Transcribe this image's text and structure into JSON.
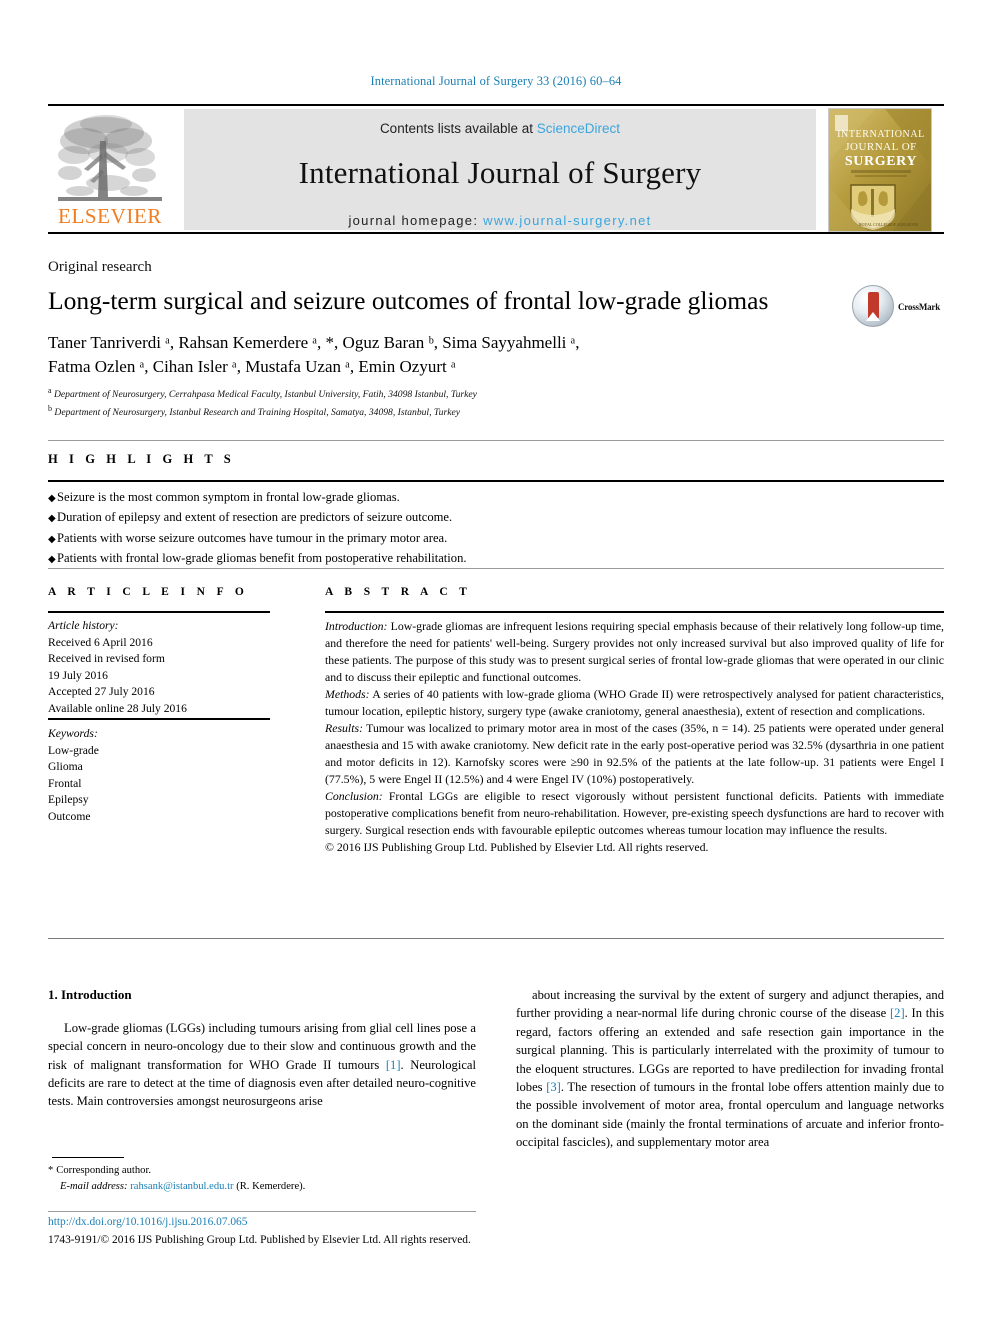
{
  "running_head": "International Journal of Surgery 33 (2016) 60–64",
  "masthead": {
    "publisher_logo_label": "ELSEVIER",
    "contents_prefix": "Contents lists available at ",
    "contents_link": "ScienceDirect",
    "journal_title": "International Journal of Surgery",
    "homepage_prefix": "journal homepage: ",
    "homepage_url": "www.journal-surgery.net",
    "cover_thumb_lines": [
      "INTERNATIONAL",
      "JOURNAL OF",
      "SURGERY"
    ]
  },
  "article": {
    "type": "Original research",
    "title": "Long-term surgical and seizure outcomes of frontal low-grade gliomas",
    "crossmark_label": "CrossMark",
    "authors_line_1": "Taner Tanriverdi ᵃ, Rahsan Kemerdere ᵃ, *, Oguz Baran ᵇ, Sima Sayyahmelli ᵃ,",
    "authors_line_2": "Fatma Ozlen ᵃ, Cihan Isler ᵃ, Mustafa Uzan ᵃ, Emin Ozyurt ᵃ",
    "authors": [
      {
        "name": "Taner Tanriverdi",
        "marks": "a"
      },
      {
        "name": "Rahsan Kemerdere",
        "marks": "a, *"
      },
      {
        "name": "Oguz Baran",
        "marks": "b"
      },
      {
        "name": "Sima Sayyahmelli",
        "marks": "a"
      },
      {
        "name": "Fatma Ozlen",
        "marks": "a"
      },
      {
        "name": "Cihan Isler",
        "marks": "a"
      },
      {
        "name": "Mustafa Uzan",
        "marks": "a"
      },
      {
        "name": "Emin Ozyurt",
        "marks": "a"
      }
    ],
    "affiliations": [
      {
        "mark": "a",
        "text": "Department of Neurosurgery, Cerrahpasa Medical Faculty, Istanbul University, Fatih, 34098 Istanbul, Turkey"
      },
      {
        "mark": "b",
        "text": "Department of Neurosurgery, Istanbul Research and Training Hospital, Samatya, 34098, Istanbul, Turkey"
      }
    ]
  },
  "highlights": {
    "heading": "H I G H L I G H T S",
    "items": [
      "Seizure is the most common symptom in frontal low-grade gliomas.",
      "Duration of epilepsy and extent of resection are predictors of seizure outcome.",
      "Patients with worse seizure outcomes have tumour in the primary motor area.",
      "Patients with frontal low-grade gliomas benefit from postoperative rehabilitation."
    ]
  },
  "article_info": {
    "heading": "A R T I C L E  I N F O",
    "history_label": "Article history:",
    "history": [
      "Received 6 April 2016",
      "Received in revised form",
      "19 July 2016",
      "Accepted 27 July 2016",
      "Available online 28 July 2016"
    ],
    "keywords_label": "Keywords:",
    "keywords": [
      "Low-grade",
      "Glioma",
      "Frontal",
      "Epilepsy",
      "Outcome"
    ]
  },
  "abstract": {
    "heading": "A B S T R A C T",
    "sections": [
      {
        "label": "Introduction:",
        "text": " Low-grade gliomas are infrequent lesions requiring special emphasis because of their relatively long follow-up time, and therefore the need for patients' well-being. Surgery provides not only increased survival but also improved quality of life for these patients. The purpose of this study was to present surgical series of frontal low-grade gliomas that were operated in our clinic and to discuss their epileptic and functional outcomes."
      },
      {
        "label": "Methods:",
        "text": " A series of 40 patients with low-grade glioma (WHO Grade II) were retrospectively analysed for patient characteristics, tumour location, epileptic history, surgery type (awake craniotomy, general anaesthesia), extent of resection and complications."
      },
      {
        "label": "Results:",
        "text": " Tumour was localized to primary motor area in most of the cases (35%, n = 14). 25 patients were operated under general anaesthesia and 15 with awake craniotomy. New deficit rate in the early post-operative period was 32.5% (dysarthria in one patient and motor deficits in 12). Karnofsky scores were ≥90 in 92.5% of the patients at the late follow-up. 31 patients were Engel I (77.5%), 5 were Engel II (12.5%) and 4 were Engel IV (10%) postoperatively."
      },
      {
        "label": "Conclusion:",
        "text": " Frontal LGGs are eligible to resect vigorously without persistent functional deficits. Patients with immediate postoperative complications benefit from neuro-rehabilitation. However, pre-existing speech dysfunctions are hard to recover with surgery. Surgical resection ends with favourable epileptic outcomes whereas tumour location may influence the results."
      }
    ],
    "copyright": "© 2016 IJS Publishing Group Ltd. Published by Elsevier Ltd. All rights reserved."
  },
  "body": {
    "section_number_title": "1. Introduction",
    "left_column_paragraph": "Low-grade gliomas (LGGs) including tumours arising from glial cell lines pose a special concern in neuro-oncology due to their slow and continuous growth and the risk of malignant transformation for WHO Grade II tumours [1]. Neurological deficits are rare to detect at the time of diagnosis even after detailed neuro-cognitive tests. Main controversies amongst neurosurgeons arise",
    "left_ref_1": "[1]",
    "right_column_paragraph": "about increasing the survival by the extent of surgery and adjunct therapies, and further providing a near-normal life during chronic course of the disease [2]. In this regard, factors offering an extended and safe resection gain importance in the surgical planning. This is particularly interrelated with the proximity of tumour to the eloquent structures. LGGs are reported to have predilection for invading frontal lobes [3]. The resection of tumours in the frontal lobe offers attention mainly due to the possible involvement of motor area, frontal operculum and language networks on the dominant side (mainly the frontal terminations of arcuate and inferior fronto-occipital fascicles), and supplementary motor area",
    "right_ref_2": "[2]",
    "right_ref_3": "[3]"
  },
  "footnote": {
    "corresponding": "Corresponding author.",
    "email_label": "E-mail address:",
    "email": "rahsank@istanbul.edu.tr",
    "email_owner": "(R. Kemerdere)."
  },
  "page_footer": {
    "doi": "http://dx.doi.org/10.1016/j.ijsu.2016.07.065",
    "issn_line": "1743-9191/© 2016 IJS Publishing Group Ltd. Published by Elsevier Ltd. All rights reserved."
  },
  "colors": {
    "link_blue": "#1a7fb5",
    "sciencedirect_blue": "#3ba5dd",
    "elsevier_orange": "#f07d22",
    "band_gray": "#e3e3e3"
  }
}
